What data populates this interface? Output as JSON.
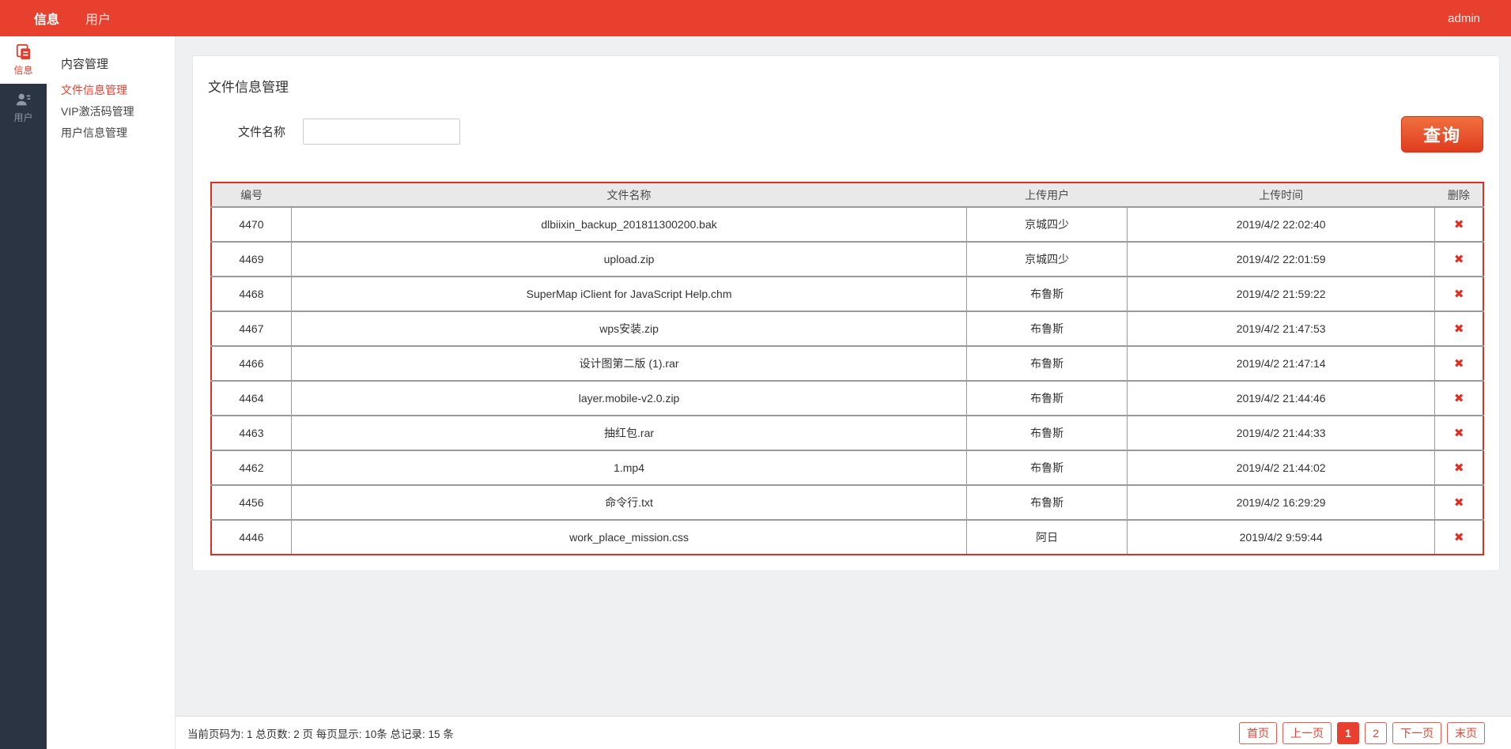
{
  "colors": {
    "accent": "#e8402f",
    "table_border": "#df2f23",
    "rail_bg": "#2a3442",
    "header_bg": "#e9e9e9"
  },
  "topbar": {
    "nav": [
      {
        "label": "信息",
        "active": true
      },
      {
        "label": "用户",
        "active": false
      }
    ],
    "user": "admin"
  },
  "rail": {
    "items": [
      {
        "label": "信息",
        "icon": "docs-icon",
        "active": true
      },
      {
        "label": "用户",
        "icon": "user-icon",
        "active": false
      }
    ]
  },
  "sidebar": {
    "heading": "内容管理",
    "items": [
      {
        "label": "文件信息管理",
        "active": true
      },
      {
        "label": "VIP激活码管理",
        "active": false
      },
      {
        "label": "用户信息管理",
        "active": false
      }
    ]
  },
  "main": {
    "title": "文件信息管理",
    "search": {
      "label": "文件名称",
      "value": "",
      "button_label": "查询"
    },
    "table": {
      "headers": [
        "编号",
        "文件名称",
        "上传用户",
        "上传时间",
        "删除"
      ],
      "col_widths": [
        "6.3%",
        "53.1%",
        "12.6%",
        "24.2%",
        "3.8%"
      ],
      "delete_icon": "✖",
      "rows": [
        {
          "id": "4470",
          "name": "dlbiixin_backup_201811300200.bak",
          "user": "京城四少",
          "time": "2019/4/2 22:02:40"
        },
        {
          "id": "4469",
          "name": "upload.zip",
          "user": "京城四少",
          "time": "2019/4/2 22:01:59"
        },
        {
          "id": "4468",
          "name": "SuperMap iClient for JavaScript Help.chm",
          "user": "布鲁斯",
          "time": "2019/4/2 21:59:22"
        },
        {
          "id": "4467",
          "name": "wps安装.zip",
          "user": "布鲁斯",
          "time": "2019/4/2 21:47:53"
        },
        {
          "id": "4466",
          "name": "设计图第二版 (1).rar",
          "user": "布鲁斯",
          "time": "2019/4/2 21:47:14"
        },
        {
          "id": "4464",
          "name": "layer.mobile-v2.0.zip",
          "user": "布鲁斯",
          "time": "2019/4/2 21:44:46"
        },
        {
          "id": "4463",
          "name": "抽红包.rar",
          "user": "布鲁斯",
          "time": "2019/4/2 21:44:33"
        },
        {
          "id": "4462",
          "name": "1.mp4",
          "user": "布鲁斯",
          "time": "2019/4/2 21:44:02"
        },
        {
          "id": "4456",
          "name": "命令行.txt",
          "user": "布鲁斯",
          "time": "2019/4/2 16:29:29"
        },
        {
          "id": "4446",
          "name": "work_place_mission.css",
          "user": "阿日",
          "time": "2019/4/2 9:59:44"
        }
      ]
    }
  },
  "pagination": {
    "summary": "当前页码为: 1 总页数:  2 页 每页显示: 10条 总记录: 15 条",
    "buttons": [
      {
        "label": "首页",
        "active": false
      },
      {
        "label": "上一页",
        "active": false
      },
      {
        "label": "1",
        "active": true
      },
      {
        "label": "2",
        "active": false
      },
      {
        "label": "下一页",
        "active": false
      },
      {
        "label": "末页",
        "active": false
      }
    ]
  }
}
